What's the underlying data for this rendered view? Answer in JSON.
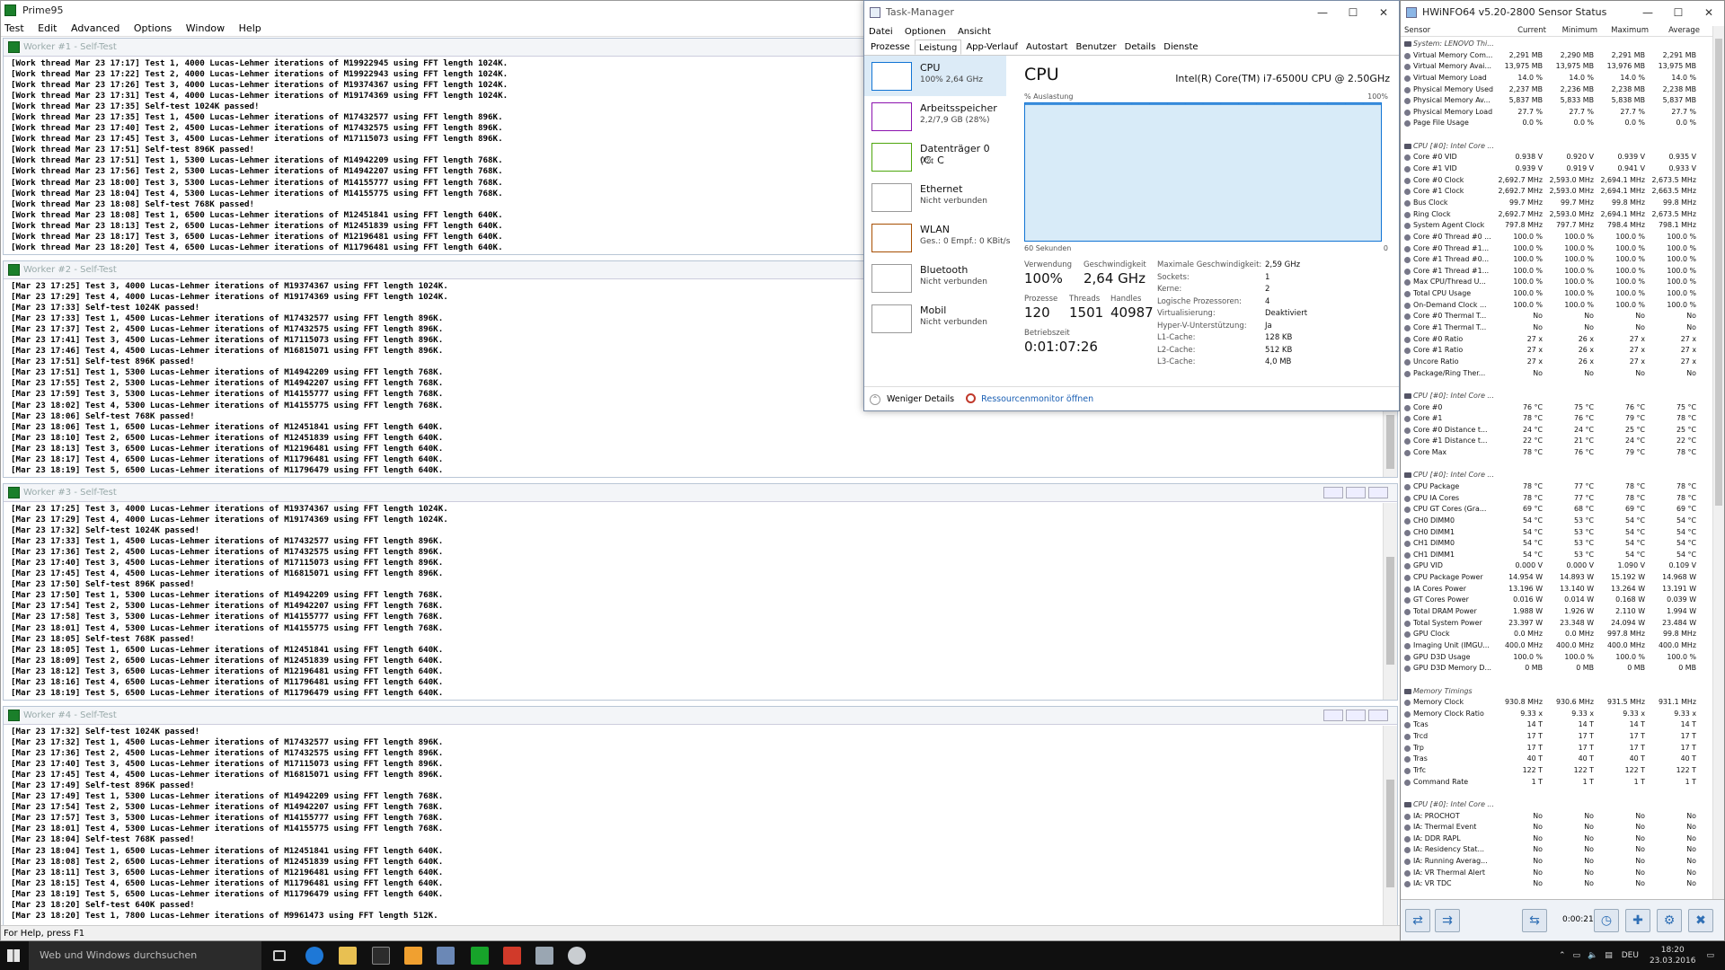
{
  "prime95": {
    "title": "Prime95",
    "menu": [
      "Test",
      "Edit",
      "Advanced",
      "Options",
      "Window",
      "Help"
    ],
    "status": "For Help, press F1",
    "workers": [
      {
        "title": "Worker #1 - Self-Test",
        "lines": [
          "[Work thread Mar 23 17:17] Test 1, 4000 Lucas-Lehmer iterations of M19922945 using FFT length 1024K.",
          "[Work thread Mar 23 17:22] Test 2, 4000 Lucas-Lehmer iterations of M19922943 using FFT length 1024K.",
          "[Work thread Mar 23 17:26] Test 3, 4000 Lucas-Lehmer iterations of M19374367 using FFT length 1024K.",
          "[Work thread Mar 23 17:31] Test 4, 4000 Lucas-Lehmer iterations of M19174369 using FFT length 1024K.",
          "[Work thread Mar 23 17:35] Self-test 1024K passed!",
          "[Work thread Mar 23 17:35] Test 1, 4500 Lucas-Lehmer iterations of M17432577 using FFT length 896K.",
          "[Work thread Mar 23 17:40] Test 2, 4500 Lucas-Lehmer iterations of M17432575 using FFT length 896K.",
          "[Work thread Mar 23 17:45] Test 3, 4500 Lucas-Lehmer iterations of M17115073 using FFT length 896K.",
          "[Work thread Mar 23 17:51] Self-test 896K passed!",
          "[Work thread Mar 23 17:51] Test 1, 5300 Lucas-Lehmer iterations of M14942209 using FFT length 768K.",
          "[Work thread Mar 23 17:56] Test 2, 5300 Lucas-Lehmer iterations of M14942207 using FFT length 768K.",
          "[Work thread Mar 23 18:00] Test 3, 5300 Lucas-Lehmer iterations of M14155777 using FFT length 768K.",
          "[Work thread Mar 23 18:04] Test 4, 5300 Lucas-Lehmer iterations of M14155775 using FFT length 768K.",
          "[Work thread Mar 23 18:08] Self-test 768K passed!",
          "[Work thread Mar 23 18:08] Test 1, 6500 Lucas-Lehmer iterations of M12451841 using FFT length 640K.",
          "[Work thread Mar 23 18:13] Test 2, 6500 Lucas-Lehmer iterations of M12451839 using FFT length 640K.",
          "[Work thread Mar 23 18:17] Test 3, 6500 Lucas-Lehmer iterations of M12196481 using FFT length 640K.",
          "[Work thread Mar 23 18:20] Test 4, 6500 Lucas-Lehmer iterations of M11796481 using FFT length 640K."
        ]
      },
      {
        "title": "Worker #2 - Self-Test",
        "lines": [
          "[Mar 23 17:25] Test 3, 4000 Lucas-Lehmer iterations of M19374367 using FFT length 1024K.",
          "[Mar 23 17:29] Test 4, 4000 Lucas-Lehmer iterations of M19174369 using FFT length 1024K.",
          "[Mar 23 17:33] Self-test 1024K passed!",
          "[Mar 23 17:33] Test 1, 4500 Lucas-Lehmer iterations of M17432577 using FFT length 896K.",
          "[Mar 23 17:37] Test 2, 4500 Lucas-Lehmer iterations of M17432575 using FFT length 896K.",
          "[Mar 23 17:41] Test 3, 4500 Lucas-Lehmer iterations of M17115073 using FFT length 896K.",
          "[Mar 23 17:46] Test 4, 4500 Lucas-Lehmer iterations of M16815071 using FFT length 896K.",
          "[Mar 23 17:51] Self-test 896K passed!",
          "[Mar 23 17:51] Test 1, 5300 Lucas-Lehmer iterations of M14942209 using FFT length 768K.",
          "[Mar 23 17:55] Test 2, 5300 Lucas-Lehmer iterations of M14942207 using FFT length 768K.",
          "[Mar 23 17:59] Test 3, 5300 Lucas-Lehmer iterations of M14155777 using FFT length 768K.",
          "[Mar 23 18:02] Test 4, 5300 Lucas-Lehmer iterations of M14155775 using FFT length 768K.",
          "[Mar 23 18:06] Self-test 768K passed!",
          "[Mar 23 18:06] Test 1, 6500 Lucas-Lehmer iterations of M12451841 using FFT length 640K.",
          "[Mar 23 18:10] Test 2, 6500 Lucas-Lehmer iterations of M12451839 using FFT length 640K.",
          "[Mar 23 18:13] Test 3, 6500 Lucas-Lehmer iterations of M12196481 using FFT length 640K.",
          "[Mar 23 18:17] Test 4, 6500 Lucas-Lehmer iterations of M11796481 using FFT length 640K.",
          "[Mar 23 18:19] Test 5, 6500 Lucas-Lehmer iterations of M11796479 using FFT length 640K."
        ]
      },
      {
        "title": "Worker #3 - Self-Test",
        "lines": [
          "[Mar 23 17:25] Test 3, 4000 Lucas-Lehmer iterations of M19374367 using FFT length 1024K.",
          "[Mar 23 17:29] Test 4, 4000 Lucas-Lehmer iterations of M19174369 using FFT length 1024K.",
          "[Mar 23 17:32] Self-test 1024K passed!",
          "[Mar 23 17:33] Test 1, 4500 Lucas-Lehmer iterations of M17432577 using FFT length 896K.",
          "[Mar 23 17:36] Test 2, 4500 Lucas-Lehmer iterations of M17432575 using FFT length 896K.",
          "[Mar 23 17:40] Test 3, 4500 Lucas-Lehmer iterations of M17115073 using FFT length 896K.",
          "[Mar 23 17:45] Test 4, 4500 Lucas-Lehmer iterations of M16815071 using FFT length 896K.",
          "[Mar 23 17:50] Self-test 896K passed!",
          "[Mar 23 17:50] Test 1, 5300 Lucas-Lehmer iterations of M14942209 using FFT length 768K.",
          "[Mar 23 17:54] Test 2, 5300 Lucas-Lehmer iterations of M14942207 using FFT length 768K.",
          "[Mar 23 17:58] Test 3, 5300 Lucas-Lehmer iterations of M14155777 using FFT length 768K.",
          "[Mar 23 18:01] Test 4, 5300 Lucas-Lehmer iterations of M14155775 using FFT length 768K.",
          "[Mar 23 18:05] Self-test 768K passed!",
          "[Mar 23 18:05] Test 1, 6500 Lucas-Lehmer iterations of M12451841 using FFT length 640K.",
          "[Mar 23 18:09] Test 2, 6500 Lucas-Lehmer iterations of M12451839 using FFT length 640K.",
          "[Mar 23 18:12] Test 3, 6500 Lucas-Lehmer iterations of M12196481 using FFT length 640K.",
          "[Mar 23 18:16] Test 4, 6500 Lucas-Lehmer iterations of M11796481 using FFT length 640K.",
          "[Mar 23 18:19] Test 5, 6500 Lucas-Lehmer iterations of M11796479 using FFT length 640K."
        ]
      },
      {
        "title": "Worker #4 - Self-Test",
        "lines": [
          "[Mar 23 17:32] Self-test 1024K passed!",
          "[Mar 23 17:32] Test 1, 4500 Lucas-Lehmer iterations of M17432577 using FFT length 896K.",
          "[Mar 23 17:36] Test 2, 4500 Lucas-Lehmer iterations of M17432575 using FFT length 896K.",
          "[Mar 23 17:40] Test 3, 4500 Lucas-Lehmer iterations of M17115073 using FFT length 896K.",
          "[Mar 23 17:45] Test 4, 4500 Lucas-Lehmer iterations of M16815071 using FFT length 896K.",
          "[Mar 23 17:49] Self-test 896K passed!",
          "[Mar 23 17:49] Test 1, 5300 Lucas-Lehmer iterations of M14942209 using FFT length 768K.",
          "[Mar 23 17:54] Test 2, 5300 Lucas-Lehmer iterations of M14942207 using FFT length 768K.",
          "[Mar 23 17:57] Test 3, 5300 Lucas-Lehmer iterations of M14155777 using FFT length 768K.",
          "[Mar 23 18:01] Test 4, 5300 Lucas-Lehmer iterations of M14155775 using FFT length 768K.",
          "[Mar 23 18:04] Self-test 768K passed!",
          "[Mar 23 18:04] Test 1, 6500 Lucas-Lehmer iterations of M12451841 using FFT length 640K.",
          "[Mar 23 18:08] Test 2, 6500 Lucas-Lehmer iterations of M12451839 using FFT length 640K.",
          "[Mar 23 18:11] Test 3, 6500 Lucas-Lehmer iterations of M12196481 using FFT length 640K.",
          "[Mar 23 18:15] Test 4, 6500 Lucas-Lehmer iterations of M11796481 using FFT length 640K.",
          "[Mar 23 18:19] Test 5, 6500 Lucas-Lehmer iterations of M11796479 using FFT length 640K.",
          "[Mar 23 18:20] Self-test 640K passed!",
          "[Mar 23 18:20] Test 1, 7800 Lucas-Lehmer iterations of M9961473 using FFT length 512K."
        ]
      }
    ]
  },
  "taskmgr": {
    "title": "Task-Manager",
    "menu": [
      "Datei",
      "Optionen",
      "Ansicht"
    ],
    "tabs": [
      "Prozesse",
      "Leistung",
      "App-Verlauf",
      "Autostart",
      "Benutzer",
      "Details",
      "Dienste"
    ],
    "active_tab": "Leistung",
    "items": [
      {
        "name": "CPU",
        "sub": "100%  2,64 GHz",
        "color": "#1174d4"
      },
      {
        "name": "Arbeitsspeicher",
        "sub": "2,2/7,9 GB (28%)",
        "color": "#8b12ae"
      },
      {
        "name": "Datenträger 0 (C: C",
        "sub": "0%",
        "color": "#4da60c"
      },
      {
        "name": "Ethernet",
        "sub": "Nicht verbunden",
        "color": "#999999"
      },
      {
        "name": "WLAN",
        "sub": "Ges.: 0  Empf.: 0 KBit/s",
        "color": "#a74f01"
      },
      {
        "name": "Bluetooth",
        "sub": "Nicht verbunden",
        "color": "#999999"
      },
      {
        "name": "Mobil",
        "sub": "Nicht verbunden",
        "color": "#999999"
      }
    ],
    "cpu_title": "CPU",
    "cpu_model": "Intel(R) Core(TM) i7-6500U CPU @ 2.50GHz",
    "graph_label": "% Auslastung",
    "graph_max": "100%",
    "graph_time": "60 Sekunden",
    "graph_min": "0",
    "utilization": 1.0,
    "stats": {
      "verwendung_label": "Verwendung",
      "verwendung": "100%",
      "speed_label": "Geschwindigkeit",
      "speed": "2,64 GHz",
      "prozesse_label": "Prozesse",
      "prozesse": "120",
      "threads_label": "Threads",
      "threads": "1501",
      "handles_label": "Handles",
      "handles": "40987",
      "uptime_label": "Betriebszeit",
      "uptime": "0:01:07:26"
    },
    "specs": [
      [
        "Maximale Geschwindigkeit:",
        "2,59 GHz"
      ],
      [
        "Sockets:",
        "1"
      ],
      [
        "Kerne:",
        "2"
      ],
      [
        "Logische Prozessoren:",
        "4"
      ],
      [
        "Virtualisierung:",
        "Deaktiviert"
      ],
      [
        "Hyper-V-Unterstützung:",
        "Ja"
      ],
      [
        "L1-Cache:",
        "128 KB"
      ],
      [
        "L2-Cache:",
        "512 KB"
      ],
      [
        "L3-Cache:",
        "4,0 MB"
      ]
    ],
    "footer_less": "Weniger Details",
    "footer_monitor": "Ressourcenmonitor öffnen"
  },
  "hwinfo": {
    "title": "HWiNFO64 v5.20-2800 Sensor Status",
    "columns": [
      "Sensor",
      "Current",
      "Minimum",
      "Maximum",
      "Average"
    ],
    "rows": [
      [
        "#",
        "System: LENOVO Thi..."
      ],
      [
        "Virtual Memory Com...",
        "2,291 MB",
        "2,290 MB",
        "2,291 MB",
        "2,291 MB"
      ],
      [
        "Virtual Memory Avai...",
        "13,975 MB",
        "13,975 MB",
        "13,976 MB",
        "13,975 MB"
      ],
      [
        "Virtual Memory Load",
        "14.0 %",
        "14.0 %",
        "14.0 %",
        "14.0 %"
      ],
      [
        "Physical Memory Used",
        "2,237 MB",
        "2,236 MB",
        "2,238 MB",
        "2,238 MB"
      ],
      [
        "Physical Memory Av...",
        "5,837 MB",
        "5,833 MB",
        "5,838 MB",
        "5,837 MB"
      ],
      [
        "Physical Memory Load",
        "27.7 %",
        "27.7 %",
        "27.7 %",
        "27.7 %"
      ],
      [
        "Page File Usage",
        "0.0 %",
        "0.0 %",
        "0.0 %",
        "0.0 %"
      ],
      [
        "",
        ""
      ],
      [
        "#",
        "CPU [#0]: Intel Core ..."
      ],
      [
        "Core #0 VID",
        "0.938 V",
        "0.920 V",
        "0.939 V",
        "0.935 V"
      ],
      [
        "Core #1 VID",
        "0.939 V",
        "0.919 V",
        "0.941 V",
        "0.933 V"
      ],
      [
        "Core #0 Clock",
        "2,692.7 MHz",
        "2,593.0 MHz",
        "2,694.1 MHz",
        "2,673.5 MHz"
      ],
      [
        "Core #1 Clock",
        "2,692.7 MHz",
        "2,593.0 MHz",
        "2,694.1 MHz",
        "2,663.5 MHz"
      ],
      [
        "Bus Clock",
        "99.7 MHz",
        "99.7 MHz",
        "99.8 MHz",
        "99.8 MHz"
      ],
      [
        "Ring Clock",
        "2,692.7 MHz",
        "2,593.0 MHz",
        "2,694.1 MHz",
        "2,673.5 MHz"
      ],
      [
        "System Agent Clock",
        "797.8 MHz",
        "797.7 MHz",
        "798.4 MHz",
        "798.1 MHz"
      ],
      [
        "Core #0 Thread #0 ...",
        "100.0 %",
        "100.0 %",
        "100.0 %",
        "100.0 %"
      ],
      [
        "Core #0 Thread #1...",
        "100.0 %",
        "100.0 %",
        "100.0 %",
        "100.0 %"
      ],
      [
        "Core #1 Thread #0...",
        "100.0 %",
        "100.0 %",
        "100.0 %",
        "100.0 %"
      ],
      [
        "Core #1 Thread #1...",
        "100.0 %",
        "100.0 %",
        "100.0 %",
        "100.0 %"
      ],
      [
        "Max CPU/Thread U...",
        "100.0 %",
        "100.0 %",
        "100.0 %",
        "100.0 %"
      ],
      [
        "Total CPU Usage",
        "100.0 %",
        "100.0 %",
        "100.0 %",
        "100.0 %"
      ],
      [
        "On-Demand Clock ...",
        "100.0 %",
        "100.0 %",
        "100.0 %",
        "100.0 %"
      ],
      [
        "Core #0 Thermal T...",
        "No",
        "No",
        "No",
        "No"
      ],
      [
        "Core #1 Thermal T...",
        "No",
        "No",
        "No",
        "No"
      ],
      [
        "Core #0 Ratio",
        "27 x",
        "26 x",
        "27 x",
        "27 x"
      ],
      [
        "Core #1 Ratio",
        "27 x",
        "26 x",
        "27 x",
        "27 x"
      ],
      [
        "Uncore Ratio",
        "27 x",
        "26 x",
        "27 x",
        "27 x"
      ],
      [
        "Package/Ring Ther...",
        "No",
        "No",
        "No",
        "No"
      ],
      [
        "",
        ""
      ],
      [
        "#",
        "CPU [#0]: Intel Core ..."
      ],
      [
        "Core #0",
        "76 °C",
        "75 °C",
        "76 °C",
        "75 °C"
      ],
      [
        "Core #1",
        "78 °C",
        "76 °C",
        "79 °C",
        "78 °C"
      ],
      [
        "Core #0 Distance t...",
        "24 °C",
        "24 °C",
        "25 °C",
        "25 °C"
      ],
      [
        "Core #1 Distance t...",
        "22 °C",
        "21 °C",
        "24 °C",
        "22 °C"
      ],
      [
        "Core Max",
        "78 °C",
        "76 °C",
        "79 °C",
        "78 °C"
      ],
      [
        "",
        ""
      ],
      [
        "#",
        "CPU [#0]: Intel Core ..."
      ],
      [
        "CPU Package",
        "78 °C",
        "77 °C",
        "78 °C",
        "78 °C"
      ],
      [
        "CPU IA Cores",
        "78 °C",
        "77 °C",
        "78 °C",
        "78 °C"
      ],
      [
        "CPU GT Cores (Gra...",
        "69 °C",
        "68 °C",
        "69 °C",
        "69 °C"
      ],
      [
        "CH0 DIMM0",
        "54 °C",
        "53 °C",
        "54 °C",
        "54 °C"
      ],
      [
        "CH0 DIMM1",
        "54 °C",
        "53 °C",
        "54 °C",
        "54 °C"
      ],
      [
        "CH1 DIMM0",
        "54 °C",
        "53 °C",
        "54 °C",
        "54 °C"
      ],
      [
        "CH1 DIMM1",
        "54 °C",
        "53 °C",
        "54 °C",
        "54 °C"
      ],
      [
        "GPU VID",
        "0.000 V",
        "0.000 V",
        "1.090 V",
        "0.109 V"
      ],
      [
        "CPU Package Power",
        "14.954 W",
        "14.893 W",
        "15.192 W",
        "14.968 W"
      ],
      [
        "IA Cores Power",
        "13.196 W",
        "13.140 W",
        "13.264 W",
        "13.191 W"
      ],
      [
        "GT Cores Power",
        "0.016 W",
        "0.014 W",
        "0.168 W",
        "0.039 W"
      ],
      [
        "Total DRAM Power",
        "1.988 W",
        "1.926 W",
        "2.110 W",
        "1.994 W"
      ],
      [
        "Total System Power",
        "23.397 W",
        "23.348 W",
        "24.094 W",
        "23.484 W"
      ],
      [
        "GPU Clock",
        "0.0 MHz",
        "0.0 MHz",
        "997.8 MHz",
        "99.8 MHz"
      ],
      [
        "Imaging Unit (IMGU...",
        "400.0 MHz",
        "400.0 MHz",
        "400.0 MHz",
        "400.0 MHz"
      ],
      [
        "GPU D3D Usage",
        "100.0 %",
        "100.0 %",
        "100.0 %",
        "100.0 %"
      ],
      [
        "GPU D3D Memory D...",
        "0 MB",
        "0 MB",
        "0 MB",
        "0 MB"
      ],
      [
        "",
        ""
      ],
      [
        "#",
        "Memory Timings"
      ],
      [
        "Memory Clock",
        "930.8 MHz",
        "930.6 MHz",
        "931.5 MHz",
        "931.1 MHz"
      ],
      [
        "Memory Clock Ratio",
        "9.33 x",
        "9.33 x",
        "9.33 x",
        "9.33 x"
      ],
      [
        "Tcas",
        "14 T",
        "14 T",
        "14 T",
        "14 T"
      ],
      [
        "Trcd",
        "17 T",
        "17 T",
        "17 T",
        "17 T"
      ],
      [
        "Trp",
        "17 T",
        "17 T",
        "17 T",
        "17 T"
      ],
      [
        "Tras",
        "40 T",
        "40 T",
        "40 T",
        "40 T"
      ],
      [
        "Trfc",
        "122 T",
        "122 T",
        "122 T",
        "122 T"
      ],
      [
        "Command Rate",
        "1 T",
        "1 T",
        "1 T",
        "1 T"
      ],
      [
        "",
        ""
      ],
      [
        "#",
        "CPU [#0]: Intel Core ..."
      ],
      [
        "IA: PROCHOT",
        "No",
        "No",
        "No",
        "No"
      ],
      [
        "IA: Thermal Event",
        "No",
        "No",
        "No",
        "No"
      ],
      [
        "IA: DDR RAPL",
        "No",
        "No",
        "No",
        "No"
      ],
      [
        "IA: Residency Stat...",
        "No",
        "No",
        "No",
        "No"
      ],
      [
        "IA: Running Averag...",
        "No",
        "No",
        "No",
        "No"
      ],
      [
        "IA: VR Thermal Alert",
        "No",
        "No",
        "No",
        "No"
      ],
      [
        "IA: VR TDC",
        "No",
        "No",
        "No",
        "No"
      ]
    ],
    "timer": "0:00:21"
  },
  "taskbar": {
    "search_placeholder": "Web und Windows durchsuchen",
    "lang": "DEU",
    "time": "18:20",
    "date": "23.03.2016"
  }
}
